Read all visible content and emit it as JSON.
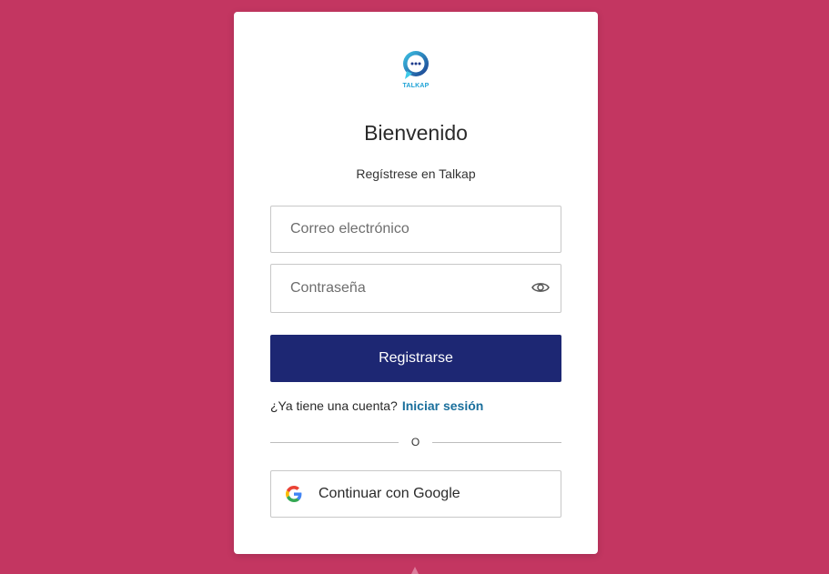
{
  "brand": {
    "name": "TALKAP",
    "logo_icon": "chat-bubble-icon",
    "accent_color": "#1fa3d6"
  },
  "page": {
    "background_color": "#c33661",
    "title": "Bienvenido",
    "subtitle": "Regístrese en Talkap"
  },
  "form": {
    "email": {
      "value": "",
      "placeholder": "Correo electrónico"
    },
    "password": {
      "value": "",
      "placeholder": "Contraseña",
      "toggle_icon": "eye-icon"
    },
    "submit_label": "Registrarse",
    "submit_color": "#1d2773"
  },
  "login_prompt": {
    "text": "¿Ya tiene una cuenta?",
    "link_label": "Iniciar sesión",
    "link_color": "#1a6f9c"
  },
  "divider": {
    "label": "O"
  },
  "google": {
    "label": "Continuar con Google",
    "icon": "google-icon"
  }
}
